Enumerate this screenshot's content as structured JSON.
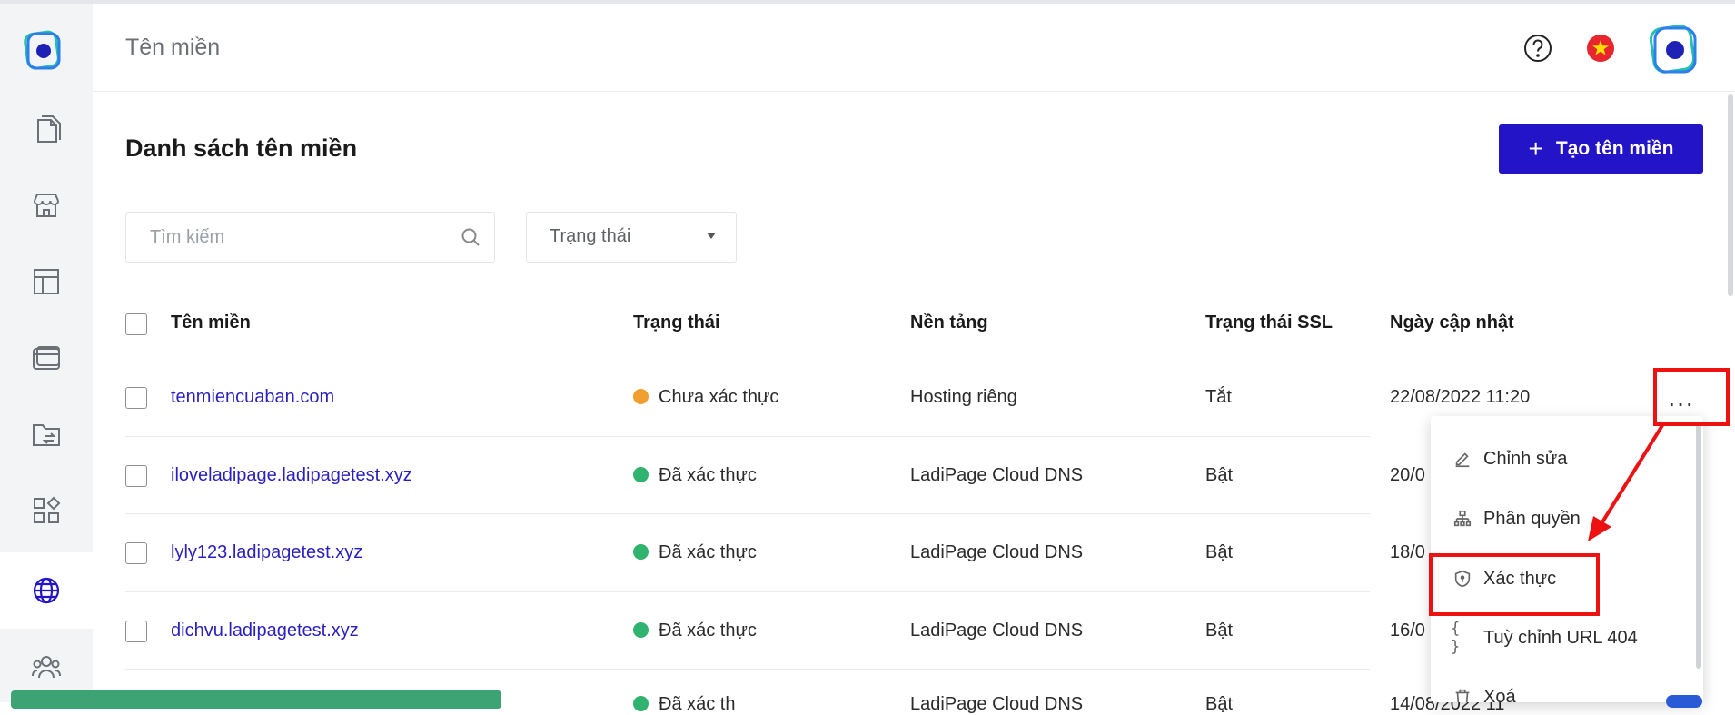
{
  "header": {
    "title": "Tên miền"
  },
  "page": {
    "section_title": "Danh sách tên miền",
    "create_button": "Tạo tên miền",
    "create_plus": "+"
  },
  "filters": {
    "search_placeholder": "Tìm kiếm",
    "status_value": "Trạng thái"
  },
  "table": {
    "columns": [
      "Tên miền",
      "Trạng thái",
      "Nền tảng",
      "Trạng thái SSL",
      "Ngày cập nhật"
    ],
    "rows": [
      {
        "domain": "tenmiencuaban.com",
        "status": "Chưa xác thực",
        "status_color": "#f0a030",
        "platform": "Hosting riêng",
        "ssl": "Tắt",
        "updated": "22/08/2022 11:20"
      },
      {
        "domain": "iloveladipage.ladipagetest.xyz",
        "status": "Đã xác thực",
        "status_color": "#2fb36f",
        "platform": "LadiPage Cloud DNS",
        "ssl": "Bật",
        "updated": "20/0"
      },
      {
        "domain": "lyly123.ladipagetest.xyz",
        "status": "Đã xác thực",
        "status_color": "#2fb36f",
        "platform": "LadiPage Cloud DNS",
        "ssl": "Bật",
        "updated": "18/0"
      },
      {
        "domain": "dichvu.ladipagetest.xyz",
        "status": "Đã xác thực",
        "status_color": "#2fb36f",
        "platform": "LadiPage Cloud DNS",
        "ssl": "Bật",
        "updated": "16/0"
      },
      {
        "domain": "",
        "status": "Đã xác th",
        "status_color": "#2fb36f",
        "platform": "LadiPage Cloud DNS",
        "ssl": "Bật",
        "updated": "14/08/2022 11"
      }
    ],
    "more_label": "..."
  },
  "menu": {
    "items": [
      {
        "label": "Chỉnh sửa",
        "icon": "edit-icon"
      },
      {
        "label": "Phân quyền",
        "icon": "sitemap-icon"
      },
      {
        "label": "Xác thực",
        "icon": "shield-icon"
      },
      {
        "label": "Tuỳ chỉnh URL 404",
        "icon": "braces-icon",
        "glyph": "{ }"
      },
      {
        "label": "Xoá",
        "icon": "trash-icon"
      }
    ]
  },
  "colors": {
    "accent": "#2314c7",
    "link": "#2a1fbf",
    "annotation": "#ee1111"
  },
  "sidebar_icons": [
    "logo",
    "pages-icon",
    "store-icon",
    "template-icon",
    "browser-icon",
    "folder-transfer-icon",
    "apps-icon",
    "globe-icon",
    "team-icon"
  ]
}
